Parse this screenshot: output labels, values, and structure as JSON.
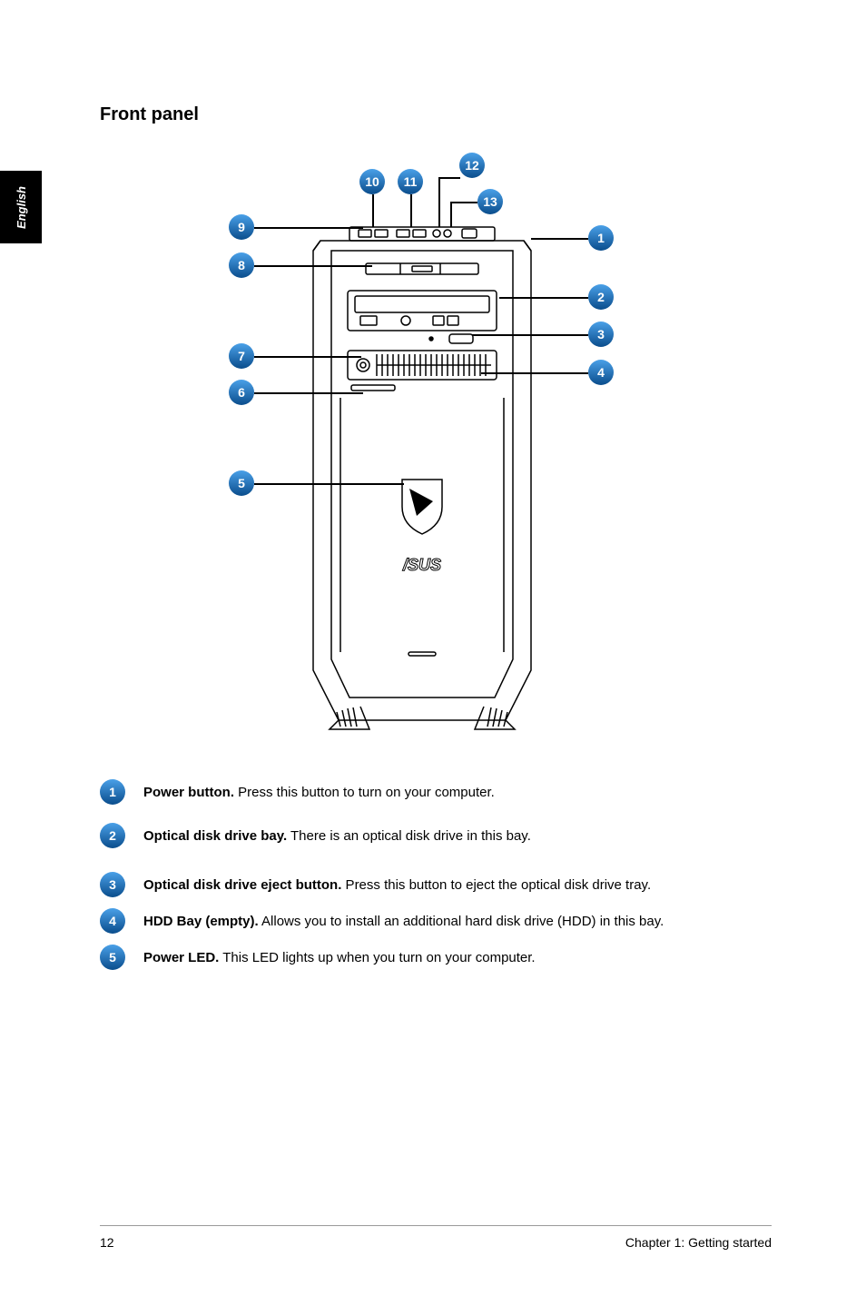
{
  "sideTab": "English",
  "title": "Front panel",
  "callouts": [
    "1",
    "2",
    "3",
    "4",
    "5",
    "6",
    "7",
    "8",
    "9",
    "10",
    "11",
    "12",
    "13"
  ],
  "items": [
    {
      "num": "1",
      "bold": "Power button.",
      "rest": " Press this button to turn on your computer."
    },
    {
      "num": "2",
      "bold": "Optical disk drive bay.",
      "rest": " There is an optical disk drive in this bay."
    },
    {
      "num": "3",
      "bold": "Optical disk drive eject button.",
      "rest": " Press this button to eject the optical disk drive tray."
    },
    {
      "num": "4",
      "bold": "HDD Bay (empty).",
      "rest": " Allows you to install an additional hard disk drive (HDD) in this bay."
    },
    {
      "num": "5",
      "bold": "Power LED.",
      "rest": " This LED lights up when you turn on your computer."
    }
  ],
  "footer": {
    "page": "12",
    "chapter": "Chapter 1: Getting started"
  }
}
